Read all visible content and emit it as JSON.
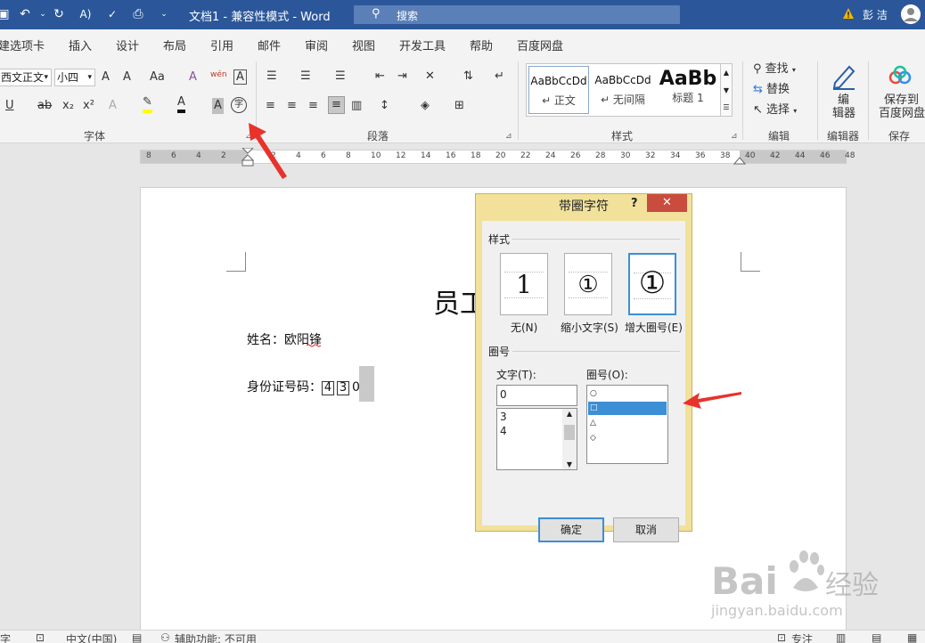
{
  "titlebar": {
    "doc_title": "文档1 - 兼容性模式 - Word",
    "search_placeholder": "搜索",
    "user_name": "彭 洁",
    "undo_icon": "undo-icon",
    "redo_icon": "redo-icon"
  },
  "menu": {
    "tabs": [
      "建选项卡",
      "插入",
      "设计",
      "布局",
      "引用",
      "邮件",
      "审阅",
      "视图",
      "开发工具",
      "帮助",
      "百度网盘"
    ]
  },
  "ribbon": {
    "font_name": "西文正文",
    "font_size": "小四",
    "groups": {
      "font": "字体",
      "paragraph": "段落",
      "styles": "样式",
      "edit": "编辑",
      "editor": "编辑器",
      "save": "保存"
    },
    "styles": [
      {
        "preview": "AaBbCcDd",
        "name": "↵ 正文"
      },
      {
        "preview": "AaBbCcDd",
        "name": "↵ 无间隔"
      },
      {
        "preview": "AaBb",
        "name": "标题 1"
      }
    ],
    "find": "查找",
    "replace": "替换",
    "select": "选择",
    "editor_btn_1": "编",
    "editor_btn_2": "辑器",
    "save_btn_1": "保存到",
    "save_btn_2": "百度网盘",
    "btn_font_grow": "A",
    "btn_font_shrink": "A",
    "btn_case": "Aa",
    "btn_clear": "A",
    "btn_pinyin": "wén",
    "btn_border": "A",
    "btn_underline": "U",
    "btn_strike": "ab",
    "btn_sub": "x₂",
    "btn_sup": "x²",
    "btn_effect": "A",
    "btn_color": "A",
    "btn_shade": "A",
    "btn_enclose": "字"
  },
  "ruler": {
    "numbers": [
      "8",
      "6",
      "4",
      "2",
      "2",
      "4",
      "6",
      "8",
      "10",
      "12",
      "14",
      "16",
      "18",
      "20",
      "22",
      "24",
      "26",
      "28",
      "30",
      "32",
      "34",
      "36",
      "38",
      "40",
      "42",
      "44",
      "46",
      "48"
    ]
  },
  "document": {
    "heading": "员工",
    "name_line": "姓名：欧阳锋",
    "id_label": "身份证号码：",
    "id_chars": [
      "4",
      "3"
    ],
    "id_tail": "0"
  },
  "dialog": {
    "title": "带圈字符",
    "help": "?",
    "close": "✕",
    "style_section": "样式",
    "style_options": [
      {
        "label": "无(N)",
        "glyph": "1"
      },
      {
        "label": "缩小文字(S)",
        "glyph": "①"
      },
      {
        "label": "增大圈号(E)",
        "glyph": "①"
      }
    ],
    "circle_section": "圈号",
    "text_label": "文字(T):",
    "text_value": "0",
    "text_list": [
      "3",
      "4"
    ],
    "circle_label": "圈号(O):",
    "circle_list": [
      "○",
      "□",
      "△",
      "◇"
    ],
    "ok": "确定",
    "cancel": "取消"
  },
  "statusbar": {
    "word_count": "字",
    "language": "中文(中国)",
    "accessibility": "辅助功能: 不可用",
    "focus": "专注"
  },
  "watermark": {
    "brand": "Bai",
    "brand2": "经验",
    "url": "jingyan.baidu.com"
  },
  "colors": {
    "title_bar": "#2b579a",
    "dialog_frame": "#f2e19a",
    "close_button": "#c94c3f",
    "selection": "#3c8fd4",
    "annotation_arrow": "#e8322b"
  }
}
